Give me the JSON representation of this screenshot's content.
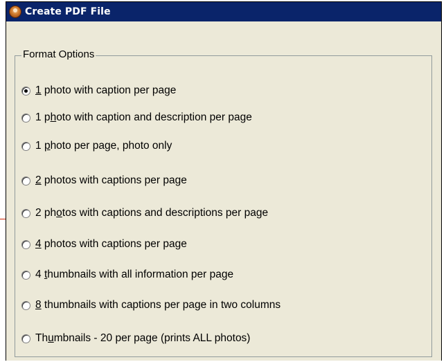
{
  "window": {
    "title": "Create PDF File",
    "icon": "photo-app-icon"
  },
  "format_options": {
    "legend": "Format Options",
    "selected_index": 0,
    "options": [
      {
        "before": "",
        "mnemonic": "1",
        "after": " photo with caption per page",
        "checked": true
      },
      {
        "before": "1 p",
        "mnemonic": "h",
        "after": "oto with caption and description per page",
        "checked": false
      },
      {
        "before": "1 ",
        "mnemonic": "p",
        "after": "hoto per page, photo only",
        "checked": false
      },
      {
        "before": "",
        "mnemonic": "2",
        "after": " photos with captions per page",
        "checked": false
      },
      {
        "before": "2 ph",
        "mnemonic": "o",
        "after": "tos with captions and descriptions per page",
        "checked": false
      },
      {
        "before": "",
        "mnemonic": "4",
        "after": " photos with captions per page",
        "checked": false
      },
      {
        "before": "4 ",
        "mnemonic": "t",
        "after": "humbnails with all information per page",
        "checked": false
      },
      {
        "before": "",
        "mnemonic": "8",
        "after": " thumbnails with captions per page in two columns",
        "checked": false
      },
      {
        "before": "Th",
        "mnemonic": "u",
        "after": "mbnails - 20 per page (prints ALL photos)",
        "checked": false
      }
    ]
  },
  "colors": {
    "titlebar": "#0a246a",
    "dialog_background": "#ece9d8",
    "groupbox_border": "#919b9c"
  }
}
